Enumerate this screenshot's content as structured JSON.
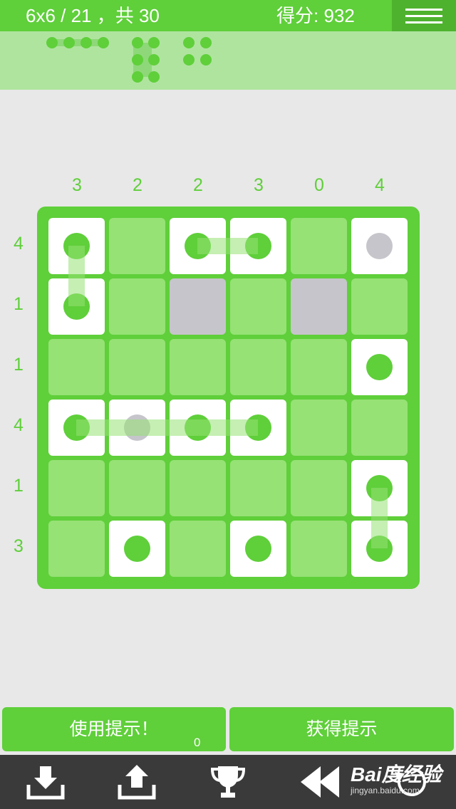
{
  "header": {
    "level_text": "6x6 / 21 ，共 30",
    "score_text": "得分: 932"
  },
  "fleet": {
    "ships": [
      {
        "size": 4,
        "orientation": "horizontal"
      },
      {
        "size": 3,
        "orientation": "vertical"
      },
      {
        "size": 2,
        "orientation": "vertical"
      },
      {
        "size": 2,
        "orientation": "vertical"
      }
    ]
  },
  "board": {
    "size": 6,
    "column_clues": [
      "3",
      "2",
      "2",
      "3",
      "0",
      "4"
    ],
    "row_clues": [
      "4",
      "1",
      "1",
      "4",
      "1",
      "3"
    ],
    "cells": [
      [
        "ship",
        "water",
        "ship",
        "ship",
        "water",
        "ship-unknown"
      ],
      [
        "ship",
        "water",
        "unknown",
        "water",
        "unknown",
        "water"
      ],
      [
        "water",
        "water",
        "water",
        "water",
        "water",
        "ship"
      ],
      [
        "ship",
        "ship-unknown",
        "ship",
        "ship",
        "water",
        "water"
      ],
      [
        "water",
        "water",
        "water",
        "water",
        "water",
        "ship"
      ],
      [
        "water",
        "ship",
        "water",
        "ship",
        "water",
        "ship"
      ]
    ]
  },
  "buttons": {
    "use_hint": "使用提示！",
    "hint_count": "0",
    "get_hints": "获得提示"
  },
  "toolbar": {
    "icons": [
      "download-icon",
      "upload-icon",
      "trophy-icon",
      "rewind-icon",
      "reset-icon"
    ]
  },
  "watermark": {
    "logo": "Bai度经验",
    "url": "jingyan.baidu.com"
  },
  "colors": {
    "accent": "#5fcf3a",
    "water": "#96e275",
    "unknown": "#c6c5cb",
    "ship": "#ffffff",
    "toolbar": "#3a3a3a"
  }
}
